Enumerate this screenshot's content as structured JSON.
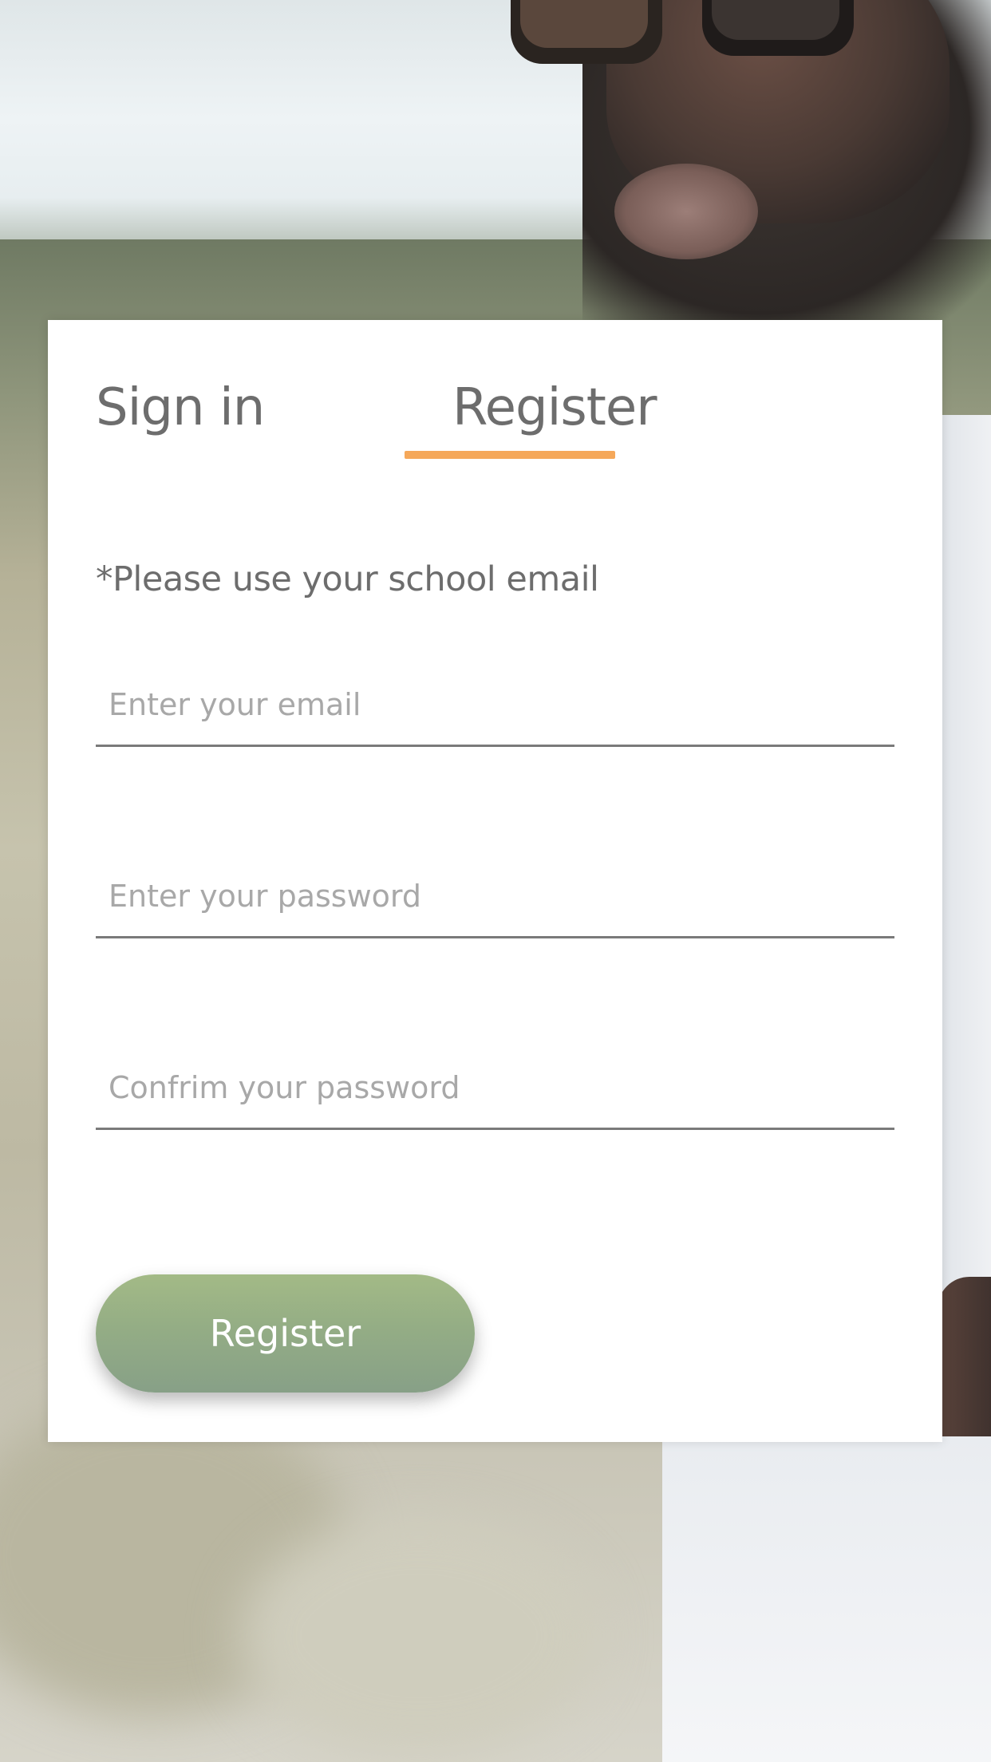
{
  "tabs": {
    "signin_label": "Sign in",
    "register_label": "Register",
    "active": "register",
    "active_color": "#f5a85a"
  },
  "form": {
    "note": "*Please use your school email",
    "email": {
      "placeholder": "Enter your email",
      "value": ""
    },
    "password": {
      "placeholder": "Enter your password",
      "value": ""
    },
    "confirm": {
      "placeholder": "Confrim your password",
      "value": ""
    },
    "submit_label": "Register",
    "submit_color": "#96ae85"
  },
  "colors": {
    "text_gray": "#6d6d6d",
    "placeholder_gray": "#a8a8a8",
    "card_bg": "#ffffff"
  }
}
